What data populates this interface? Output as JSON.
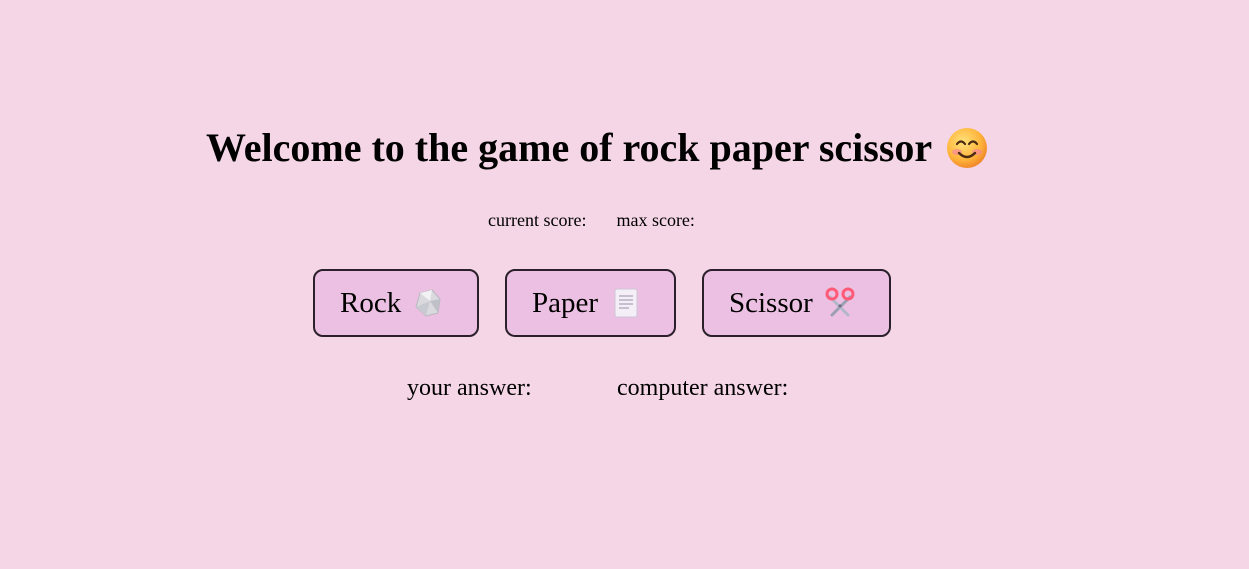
{
  "header": {
    "title": "Welcome to the game of rock paper scissor",
    "title_icon": "smiling-face-emoji"
  },
  "scores": {
    "current_label": "current score:",
    "current_value": "",
    "max_label": "max score:",
    "max_value": ""
  },
  "choices": [
    {
      "label": "Rock",
      "icon": "rock-emoji"
    },
    {
      "label": "Paper",
      "icon": "page-emoji"
    },
    {
      "label": "Scissor",
      "icon": "scissors-emoji"
    }
  ],
  "answers": {
    "your_label": "your answer:",
    "your_value": "",
    "computer_label": "computer answer:",
    "computer_value": ""
  },
  "colors": {
    "background": "#f5d6e6",
    "button_bg": "#ecc0e2",
    "button_border": "#2a1f2a"
  }
}
